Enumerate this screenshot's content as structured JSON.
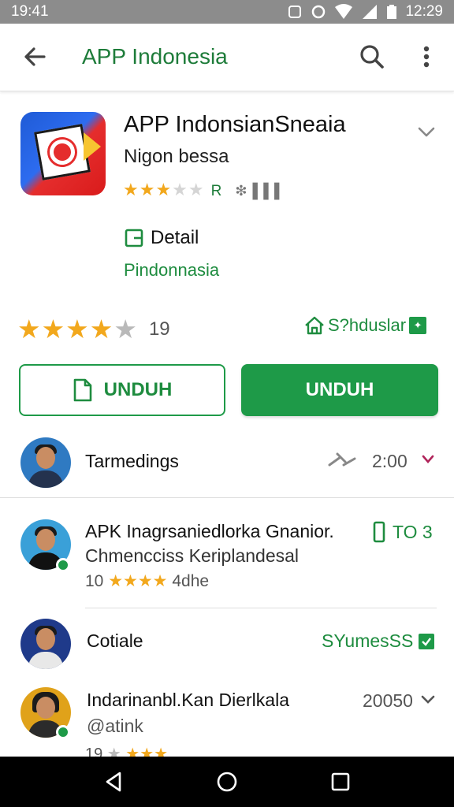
{
  "status_bar": {
    "time_left": "19:41",
    "time_right": "12:29"
  },
  "app_bar": {
    "title": "APP Indonesia",
    "icons": [
      "back-arrow-icon",
      "search-icon",
      "more-vert-icon"
    ]
  },
  "app": {
    "title": "APP IndonsianSneaia",
    "subtitle": "Nigon bessa",
    "rating_letter": "R",
    "meta": "❇ ▌▌▌",
    "detail_label": "Detail",
    "detail_sub": "Pindonnasia",
    "rating_count": "19",
    "rating_value": 4.5,
    "badge_text": "S?hduslar"
  },
  "buttons": {
    "outline_label": "UNDUH",
    "fill_label": "UNDUH"
  },
  "list": [
    {
      "title": "Tarmedings",
      "right": "2:00"
    },
    {
      "title": "APK Inagrsaniedlorka Gnanior.",
      "subtitle": "Chmencciss Keriplandesal",
      "count": "10",
      "meta": "4dhe",
      "right": "TO 3"
    },
    {
      "title": "Cotiale",
      "right": "SYumesSS"
    },
    {
      "title": "Indarinanbl.Kan Dierlkala",
      "subtitle": "@atink",
      "count": "19",
      "right": "20050"
    }
  ],
  "colors": {
    "accent_green": "#1e9a48",
    "star_gold": "#f2a81d",
    "status_bar": "#8c8c8c",
    "nav_bar": "#000000"
  }
}
